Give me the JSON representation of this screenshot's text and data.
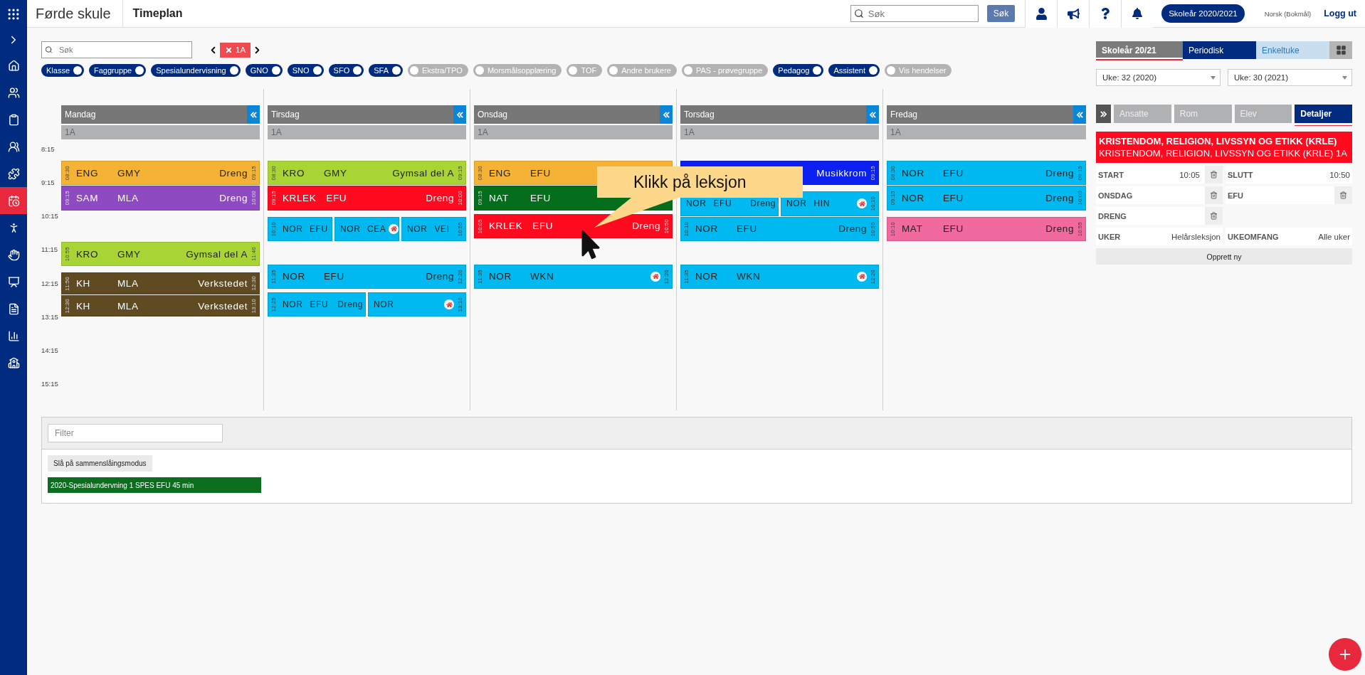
{
  "app": {
    "school": "Førde skule",
    "page": "Timeplan"
  },
  "topbar": {
    "search_placeholder": "Søk",
    "search_button": "Søk",
    "school_year": "Skoleår 2020/2021",
    "language": "Norsk (Bokmål)",
    "logout": "Logg ut"
  },
  "sidebar": {
    "items": [
      {
        "selected": false
      },
      {
        "selected": false
      },
      {
        "selected": false
      },
      {
        "selected": false
      },
      {
        "selected": false
      },
      {
        "selected": true
      },
      {
        "selected": false
      },
      {
        "selected": false
      },
      {
        "selected": false
      },
      {
        "selected": false
      },
      {
        "selected": false
      },
      {
        "selected": false
      }
    ]
  },
  "search": {
    "placeholder": "Søk"
  },
  "class_filter": {
    "label": "1A"
  },
  "filters": [
    {
      "label": "Klasse",
      "on": true
    },
    {
      "label": "Faggruppe",
      "on": true
    },
    {
      "label": "Spesialundervisning",
      "on": true
    },
    {
      "label": "GNO",
      "on": true
    },
    {
      "label": "SNO",
      "on": true
    },
    {
      "label": "SFO",
      "on": true
    },
    {
      "label": "SFA",
      "on": true
    },
    {
      "label": "Ekstra/TPO",
      "on": false
    },
    {
      "label": "Morsmålsopplæring",
      "on": false
    },
    {
      "label": "TOF",
      "on": false
    },
    {
      "label": "Andre brukere",
      "on": false
    },
    {
      "label": "PAS - prøvegruppe",
      "on": false
    },
    {
      "label": "Pedagog",
      "on": true
    },
    {
      "label": "Assistent",
      "on": true
    },
    {
      "label": "Vis hendelser",
      "on": false
    }
  ],
  "view_tabs": [
    {
      "label": "Skoleår 20/21",
      "selected": true,
      "color": "#7b7b7b"
    },
    {
      "label": "Periodisk",
      "selected": false,
      "color": "#002b7f"
    },
    {
      "label": "Enkeltuke",
      "selected": false,
      "color": "#c9dff0"
    }
  ],
  "week_selects": [
    "Uke: 32 (2020)",
    "Uke: 30 (2021)"
  ],
  "time_labels": [
    "8:15",
    "9:15",
    "10:15",
    "11:15",
    "12:15",
    "13:15",
    "14:15",
    "15:15"
  ],
  "days": [
    {
      "name": "Mandag",
      "group": "1A",
      "lessons": [
        {
          "start": "08:30",
          "end": "09:15",
          "color": "#f5b335",
          "pieces": [
            {
              "subject": "ENG",
              "teacher": "GMY",
              "room": "Dreng"
            }
          ]
        },
        {
          "start": "09:15",
          "end": "10:00",
          "color": "#8e4ac0",
          "pieces": [
            {
              "subject": "SAM",
              "teacher": "MLA",
              "room": "Dreng"
            }
          ]
        },
        {
          "start": "10:55",
          "end": "11:40",
          "color": "#a9d436",
          "pieces": [
            {
              "subject": "KRO",
              "teacher": "GMY",
              "room": "Gymsal del A"
            }
          ]
        },
        {
          "start": "11:50",
          "end": "12:30",
          "color": "#604a22",
          "pieces": [
            {
              "subject": "KH",
              "teacher": "MLA",
              "room": "Verkstedet"
            }
          ]
        },
        {
          "start": "12:30",
          "end": "13:10",
          "color": "#604a22",
          "pieces": [
            {
              "subject": "KH",
              "teacher": "MLA",
              "room": "Verkstedet"
            }
          ]
        }
      ]
    },
    {
      "name": "Tirsdag",
      "group": "1A",
      "lessons": [
        {
          "start": "08:30",
          "end": "09:15",
          "color": "#a9d436",
          "pieces": [
            {
              "subject": "KRO",
              "teacher": "GMY",
              "room": "Gymsal del A"
            }
          ]
        },
        {
          "start": "09:15",
          "end": "10:00",
          "color": "#ff0a1e",
          "pieces": [
            {
              "subject": "KRLEK",
              "teacher": "EFU",
              "room": "Dreng"
            }
          ]
        },
        {
          "start": "10:10",
          "end": "10:55",
          "color": "#00b9f0",
          "pieces": [
            {
              "subject": "NOR",
              "teacher": "EFU"
            },
            {
              "subject": "NOR",
              "teacher": "CEA",
              "home": true
            },
            {
              "subject": "NOR",
              "teacher": "VEI"
            }
          ]
        },
        {
          "start": "11:35",
          "end": "12:20",
          "color": "#00b9f0",
          "pieces": [
            {
              "subject": "NOR",
              "teacher": "EFU",
              "room": "Dreng"
            }
          ]
        },
        {
          "start": "12:25",
          "end": "13:10",
          "color": "#00b9f0",
          "pieces": [
            {
              "subject": "NOR",
              "teacher": "EFU",
              "room": "Dreng"
            },
            {
              "subject": "NOR",
              "home": true
            }
          ]
        }
      ]
    },
    {
      "name": "Onsdag",
      "group": "1A",
      "lessons": [
        {
          "start": "08:30",
          "color": "#f5b335",
          "pieces": [
            {
              "subject": "ENG",
              "teacher": "EFU"
            }
          ]
        },
        {
          "start": "09:15",
          "color": "#056e1c",
          "pieces": [
            {
              "subject": "NAT",
              "teacher": "EFU"
            }
          ]
        },
        {
          "start": "10:05",
          "end": "10:50",
          "color": "#ff0a1e",
          "pieces": [
            {
              "subject": "KRLEK",
              "teacher": "EFU",
              "room": "Dreng"
            }
          ]
        },
        {
          "start": "11:35",
          "end": "12:20",
          "color": "#00b9f0",
          "pieces": [
            {
              "subject": "NOR",
              "teacher": "WKN",
              "home": true
            }
          ]
        }
      ]
    },
    {
      "name": "Torsdag",
      "group": "1A",
      "lessons": [
        {
          "end": "09:15",
          "color": "#0a1ff0",
          "pieces": [
            {
              "room": "Musikkrom"
            }
          ]
        },
        {
          "end": "10:10",
          "color": "#00b9f0",
          "pieces": [
            {
              "subject": "NOR",
              "teacher": "EFU",
              "room": "Dreng"
            },
            {
              "subject": "NOR",
              "teacher": "HIN",
              "home": true
            }
          ]
        },
        {
          "start": "10:10",
          "end": "10:55",
          "color": "#00b9f0",
          "pieces": [
            {
              "subject": "NOR",
              "teacher": "EFU",
              "room": "Dreng"
            }
          ]
        },
        {
          "start": "11:35",
          "end": "12:20",
          "color": "#00b9f0",
          "pieces": [
            {
              "subject": "NOR",
              "teacher": "WKN",
              "home": true
            }
          ]
        }
      ]
    },
    {
      "name": "Fredag",
      "group": "1A",
      "lessons": [
        {
          "start": "08:30",
          "end": "09:15",
          "color": "#00b9f0",
          "pieces": [
            {
              "subject": "NOR",
              "teacher": "EFU",
              "room": "Dreng"
            }
          ]
        },
        {
          "start": "09:15",
          "end": "10:00",
          "color": "#00b9f0",
          "pieces": [
            {
              "subject": "NOR",
              "teacher": "EFU",
              "room": "Dreng"
            }
          ]
        },
        {
          "start": "10:10",
          "end": "10:55",
          "color": "#f06aa0",
          "pieces": [
            {
              "subject": "MAT",
              "teacher": "EFU",
              "room": "Dreng"
            }
          ]
        }
      ]
    }
  ],
  "detail_tabs": [
    {
      "label": "Ansatte",
      "selected": false
    },
    {
      "label": "Rom",
      "selected": false
    },
    {
      "label": "Elev",
      "selected": false
    },
    {
      "label": "Detaljer",
      "selected": true
    }
  ],
  "details": {
    "title": "KRISTENDOM, RELIGION, LIVSSYN OG ETIKK (KRLE)",
    "subtitle": "KRISTENDOM, RELIGION, LIVSSYN OG ETIKK (KRLE) 1A",
    "color": "#ff0a1e",
    "rows": [
      [
        {
          "label": "START",
          "value": "10:05",
          "deletable": true
        },
        {
          "label": "SLUTT",
          "value": "10:50",
          "deletable": false
        }
      ],
      [
        {
          "label": "ONSDAG",
          "deletable": true
        },
        {
          "label": "EFU",
          "deletable": true
        }
      ],
      [
        {
          "label": "DRENG",
          "deletable": true
        }
      ],
      [
        {
          "label": "UKER",
          "value": "Helårsleksjon",
          "deletable": false
        },
        {
          "label": "UKEOMFANG",
          "value": "Alle uker",
          "deletable": false
        }
      ]
    ],
    "create_button": "Opprett ny"
  },
  "bottom_panel": {
    "filter_placeholder": "Filter",
    "merge_button": "Slå på sammenslåingsmodus",
    "items": [
      {
        "label": "2020-Spesialundervning 1 SPES EFU 45 min",
        "color": "#0a6e1e"
      }
    ]
  },
  "callout": {
    "text": "Klikk på leksjon"
  }
}
